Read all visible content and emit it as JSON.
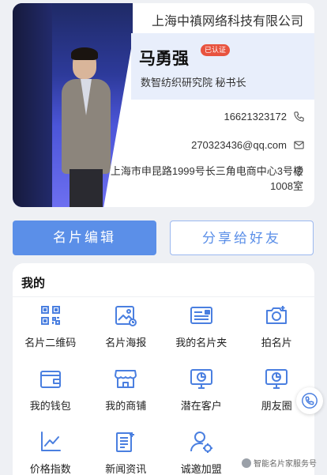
{
  "card": {
    "company": "上海中禛网络科技有限公司",
    "name": "马勇强",
    "badge": "已认证",
    "title": "数智纺织研究院 秘书长",
    "phone": "16621323172",
    "email": "270323436@qq.com",
    "address": "上海市申昆路1999号长三角电商中心3号楼1008室"
  },
  "actions": {
    "edit_label": "名片编辑",
    "share_label": "分享给好友"
  },
  "my": {
    "title": "我的",
    "items": [
      {
        "label": "名片二维码",
        "icon": "qr-code-icon"
      },
      {
        "label": "名片海报",
        "icon": "poster-icon"
      },
      {
        "label": "我的名片夹",
        "icon": "card-holder-icon"
      },
      {
        "label": "拍名片",
        "icon": "camera-icon"
      },
      {
        "label": "我的钱包",
        "icon": "wallet-icon"
      },
      {
        "label": "我的商铺",
        "icon": "shop-icon"
      },
      {
        "label": "潜在客户",
        "icon": "monitor-chart-icon"
      },
      {
        "label": "朋友圈",
        "icon": "monitor-chart-icon"
      },
      {
        "label": "价格指数",
        "icon": "line-chart-icon"
      },
      {
        "label": "新闻资讯",
        "icon": "news-icon"
      },
      {
        "label": "诚邀加盟",
        "icon": "user-gear-icon"
      }
    ]
  },
  "floating": {
    "call_icon": "phone-24h-icon",
    "watermark": "智能名片家服务号"
  },
  "colors": {
    "accent": "#5b8fe8",
    "badge": "#e8533f",
    "icon": "#4a7fe0"
  }
}
